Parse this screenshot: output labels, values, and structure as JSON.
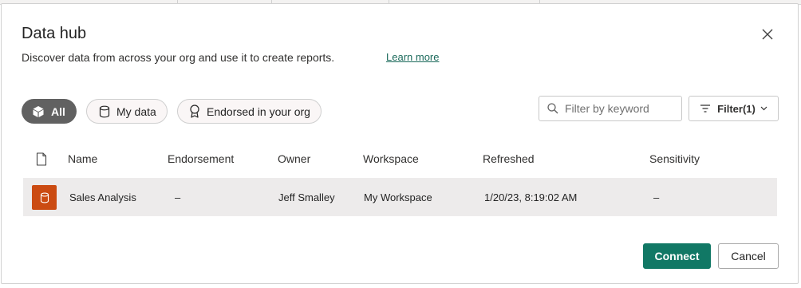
{
  "dialog": {
    "title": "Data hub",
    "subtitle": "Discover data from across your org and use it to create reports.",
    "learn_more": "Learn more"
  },
  "tabs": [
    {
      "label": "All",
      "icon": "cube-icon",
      "active": true
    },
    {
      "label": "My data",
      "icon": "database-icon",
      "active": false
    },
    {
      "label": "Endorsed in your org",
      "icon": "ribbon-icon",
      "active": false
    }
  ],
  "search": {
    "placeholder": "Filter by keyword",
    "value": ""
  },
  "filter": {
    "label": "Filter(1)"
  },
  "table": {
    "columns": [
      "Name",
      "Endorsement",
      "Owner",
      "Workspace",
      "Refreshed",
      "Sensitivity"
    ],
    "rows": [
      {
        "name": "Sales Analysis",
        "endorsement": "–",
        "owner": "Jeff Smalley",
        "workspace": "My Workspace",
        "refreshed": "1/20/23, 8:19:02 AM",
        "sensitivity": "–"
      }
    ]
  },
  "buttons": {
    "connect": "Connect",
    "cancel": "Cancel"
  },
  "colors": {
    "accent": "#117865",
    "dataset_icon": "#cb4b12",
    "active_tab": "#616161",
    "link": "#1b6a5b"
  }
}
